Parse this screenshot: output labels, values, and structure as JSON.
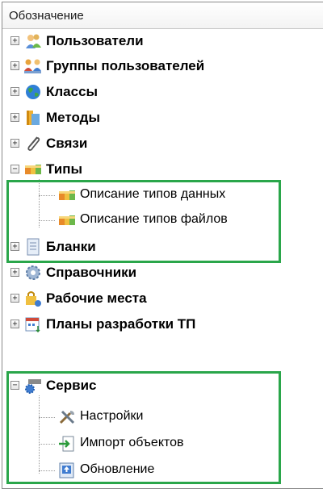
{
  "header": {
    "title": "Обозначение"
  },
  "tree": {
    "users": "Пользователи",
    "user_groups": "Группы пользователей",
    "classes": "Классы",
    "methods": "Методы",
    "links": "Связи",
    "types": "Типы",
    "types_children": {
      "data_types": "Описание типов данных",
      "file_types": "Описание типов файлов"
    },
    "forms": "Бланки",
    "references": "Справочники",
    "workplaces": "Рабочие места",
    "dev_plans": "Планы разработки ТП",
    "service": "Сервис",
    "service_children": {
      "settings": "Настройки",
      "import": "Импорт объектов",
      "update": "Обновление"
    }
  },
  "highlight_color": "#2aa64a",
  "icons": {
    "users": "users-icon",
    "groups": "user-groups-icon",
    "classes": "globe-icon",
    "methods": "methods-icon",
    "links": "paperclip-icon",
    "types": "cubes-icon",
    "forms": "form-icon",
    "references": "gear-icon",
    "workplaces": "workplace-lock-icon",
    "plans": "calendar-plan-icon",
    "service": "service-icon",
    "settings": "tools-icon",
    "import": "import-icon",
    "update": "update-icon"
  }
}
